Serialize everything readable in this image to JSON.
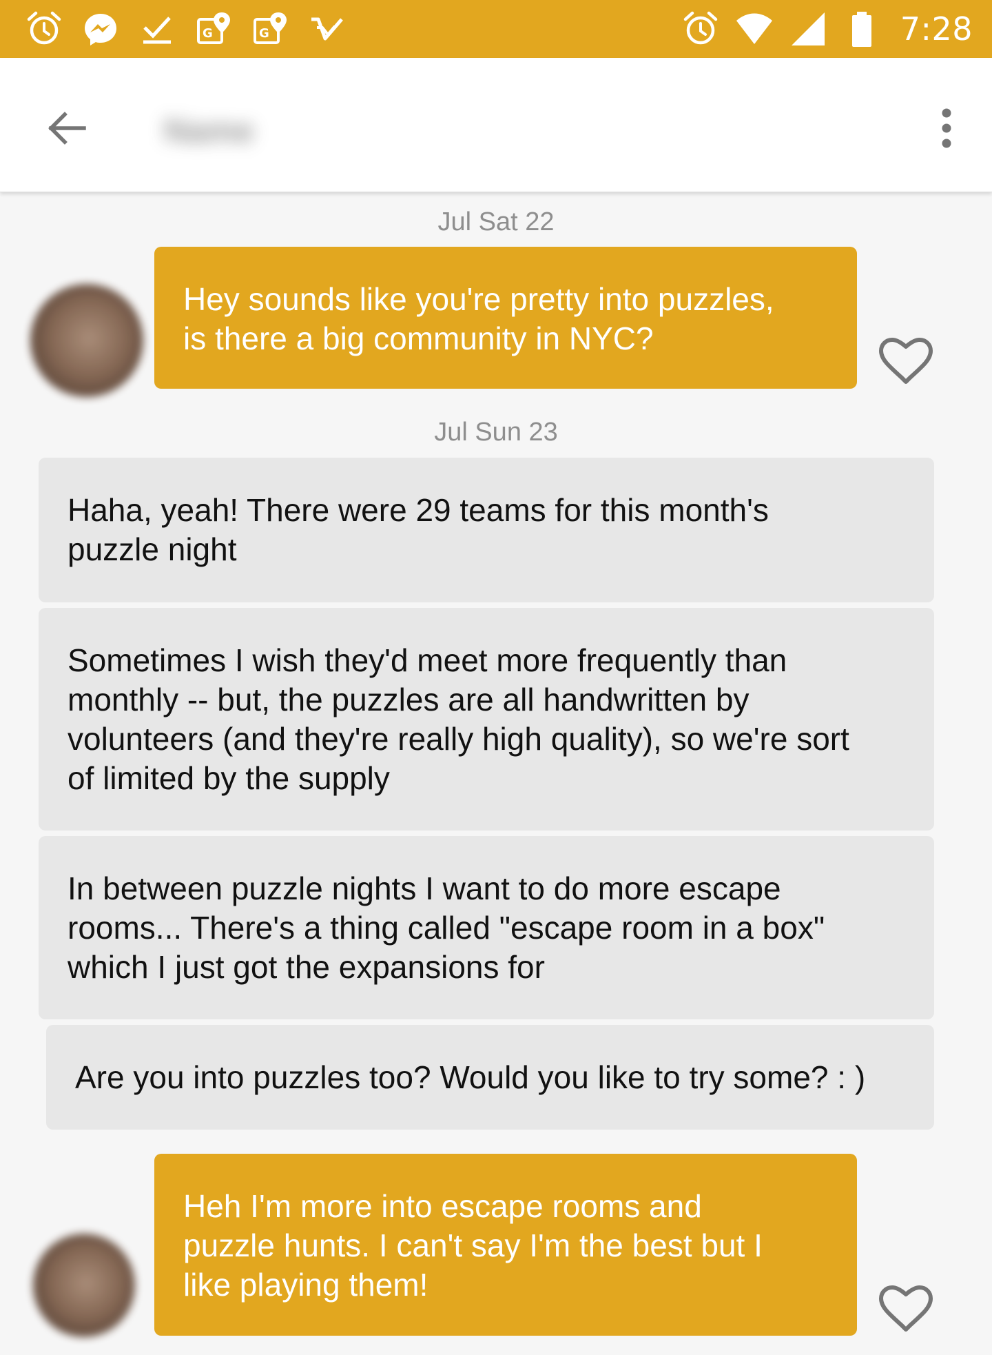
{
  "status_bar": {
    "time": "7:28",
    "background_color": "#e2a71f",
    "left_icons": [
      "alarm-icon",
      "messenger-icon",
      "download-done-icon",
      "maps-icon",
      "maps-icon",
      "inbox-done-icon"
    ],
    "right_icons": [
      "alarm-icon",
      "wifi-icon",
      "signal-icon",
      "battery-icon"
    ]
  },
  "header": {
    "contact_name": "Name",
    "back_icon": "arrow-back-icon",
    "menu_icon": "more-vert-icon"
  },
  "chat": {
    "date_1": "Jul Sat 22",
    "date_2": "Jul Sun 23",
    "messages": [
      {
        "direction": "outgoing",
        "lines": [
          "Hey sounds like you're pretty into puzzles,",
          "is there a big community in NYC?"
        ]
      },
      {
        "direction": "incoming",
        "lines": [
          "Haha, yeah! There were 29 teams for this month's",
          "puzzle night"
        ]
      },
      {
        "direction": "incoming",
        "lines": [
          "Sometimes I wish they'd meet more frequently than",
          "monthly -- but, the puzzles are all handwritten by",
          "volunteers (and they're really high quality), so we're sort",
          "of limited by the supply"
        ]
      },
      {
        "direction": "incoming",
        "lines": [
          "In between puzzle nights I want to do more escape",
          "rooms... There's a thing called \"escape room in a box\"",
          "which I just got the expansions for"
        ]
      },
      {
        "direction": "incoming",
        "lines": [
          "Are you into puzzles too? Would you like to try some? : )"
        ]
      },
      {
        "direction": "outgoing",
        "lines": [
          "Heh I'm more into escape rooms and",
          "puzzle hunts. I can't say I'm the best but I",
          "like playing them!"
        ]
      }
    ],
    "like_icon": "heart-outline-icon",
    "outgoing_color": "#e2a71f",
    "incoming_color": "#e7e7e7"
  }
}
